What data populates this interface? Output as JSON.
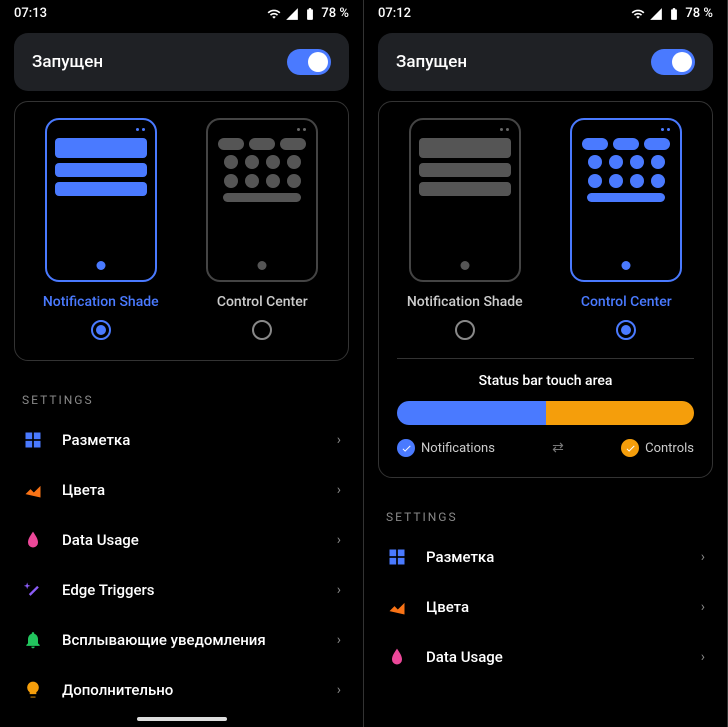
{
  "left": {
    "status": {
      "time": "07:13",
      "battery": "78 %"
    },
    "running_label": "Запущен",
    "modes": [
      {
        "label": "Notification Shade",
        "selected": true
      },
      {
        "label": "Control Center",
        "selected": false
      }
    ],
    "section_header": "SETTINGS",
    "items": [
      {
        "icon": "layout-icon",
        "label": "Разметка",
        "color": "#4a7aff"
      },
      {
        "icon": "palette-icon",
        "label": "Цвета",
        "color": "#f97316"
      },
      {
        "icon": "flame-icon",
        "label": "Data Usage",
        "color": "#ec4899"
      },
      {
        "icon": "wand-icon",
        "label": "Edge Triggers",
        "color": "#8b5cf6"
      },
      {
        "icon": "bell-icon",
        "label": "Всплывающие уведомления",
        "color": "#22c55e"
      },
      {
        "icon": "bulb-icon",
        "label": "Дополнительно",
        "color": "#f59e0b"
      }
    ]
  },
  "right": {
    "status": {
      "time": "07:12",
      "battery": "78 %"
    },
    "running_label": "Запущен",
    "modes": [
      {
        "label": "Notification Shade",
        "selected": false
      },
      {
        "label": "Control Center",
        "selected": true
      }
    ],
    "touch_area": {
      "title": "Status bar touch area",
      "left_label": "Notifications",
      "right_label": "Controls",
      "swap": "⇄"
    },
    "section_header": "SETTINGS",
    "items": [
      {
        "icon": "layout-icon",
        "label": "Разметка",
        "color": "#4a7aff"
      },
      {
        "icon": "palette-icon",
        "label": "Цвета",
        "color": "#f97316"
      },
      {
        "icon": "flame-icon",
        "label": "Data Usage",
        "color": "#ec4899"
      }
    ]
  }
}
